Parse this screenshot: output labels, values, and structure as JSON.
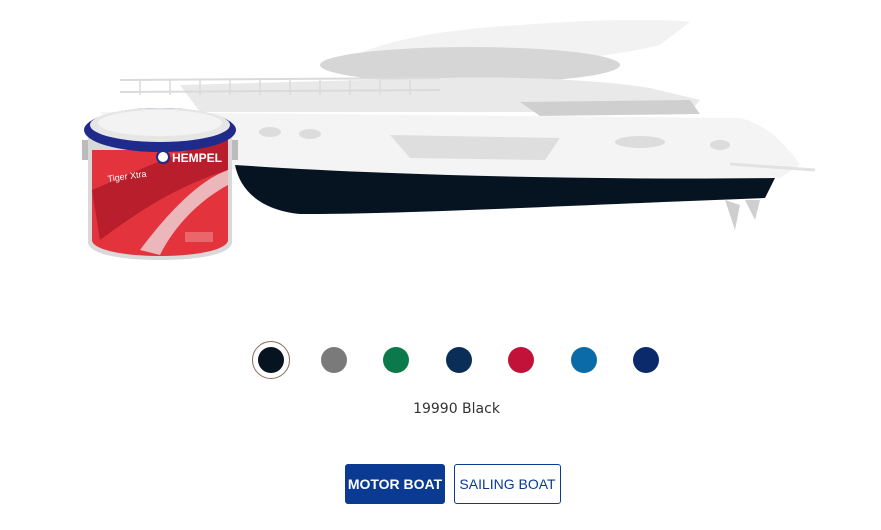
{
  "product": {
    "brand_label": "HEMPEL",
    "product_label": "Tiger Xtra"
  },
  "hull_color": "#061421",
  "swatches": [
    {
      "name": "black-swatch",
      "color": "#061421",
      "selected": true
    },
    {
      "name": "grey-swatch",
      "color": "#7a7a7a",
      "selected": false
    },
    {
      "name": "green-swatch",
      "color": "#0a7a4a",
      "selected": false
    },
    {
      "name": "dark-blue-swatch",
      "color": "#0a2e57",
      "selected": false
    },
    {
      "name": "red-swatch",
      "color": "#c2123a",
      "selected": false
    },
    {
      "name": "ocean-blue-swatch",
      "color": "#0b6ba6",
      "selected": false
    },
    {
      "name": "navy-swatch",
      "color": "#0b2a6b",
      "selected": false
    }
  ],
  "selected_color_label": "19990 Black",
  "boat_types": {
    "motor_boat": "MOTOR BOAT",
    "sailing_boat": "SAILING BOAT"
  },
  "colors": {
    "accent": "#0b3a93",
    "selected_ring": "#8a6a5a"
  }
}
